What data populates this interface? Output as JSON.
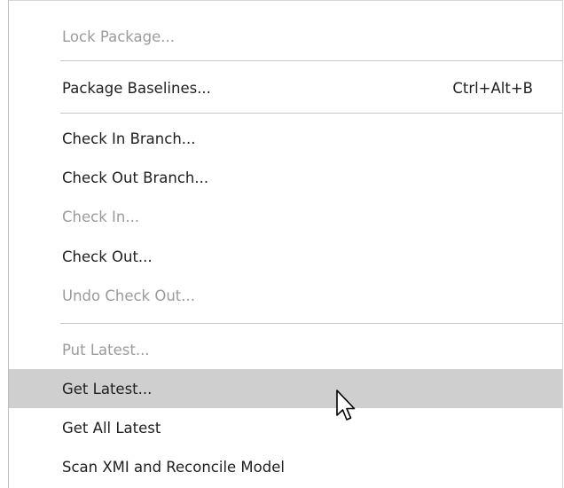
{
  "menu": {
    "items": [
      {
        "label": "Lock Package...",
        "shortcut": "",
        "disabled": true
      },
      {
        "label": "Package Baselines...",
        "shortcut": "Ctrl+Alt+B",
        "disabled": false
      },
      {
        "label": "Check In Branch...",
        "shortcut": "",
        "disabled": false
      },
      {
        "label": "Check Out Branch...",
        "shortcut": "",
        "disabled": false
      },
      {
        "label": "Check In...",
        "shortcut": "",
        "disabled": true
      },
      {
        "label": "Check Out...",
        "shortcut": "",
        "disabled": false
      },
      {
        "label": "Undo Check Out...",
        "shortcut": "",
        "disabled": true
      },
      {
        "label": "Put Latest...",
        "shortcut": "",
        "disabled": true
      },
      {
        "label": "Get Latest...",
        "shortcut": "",
        "disabled": false,
        "highlighted": true
      },
      {
        "label": "Get All Latest",
        "shortcut": "",
        "disabled": false
      },
      {
        "label": "Scan XMI and Reconcile Model",
        "shortcut": "",
        "disabled": false
      }
    ]
  },
  "colors": {
    "text": "#1f1f1f",
    "disabled_text": "#9b9b9b",
    "highlight": "#cfcfcf",
    "separator": "#c6c6c6"
  },
  "icons": {
    "cursor": "mouse-pointer-icon"
  }
}
